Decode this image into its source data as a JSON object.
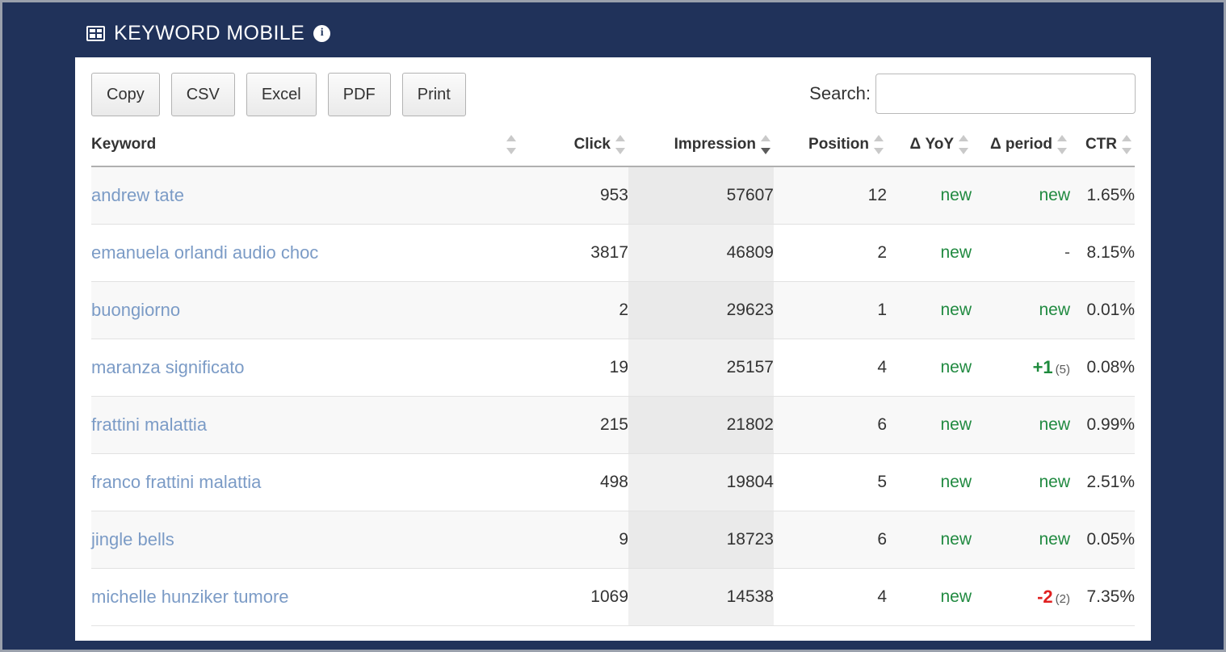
{
  "header": {
    "title": "KEYWORD MOBILE",
    "grid_icon": "grid-table-icon",
    "info_icon": "info-circle-icon"
  },
  "toolbar": {
    "buttons": [
      {
        "label": "Copy",
        "name": "copy-button"
      },
      {
        "label": "CSV",
        "name": "csv-button"
      },
      {
        "label": "Excel",
        "name": "excel-button"
      },
      {
        "label": "PDF",
        "name": "pdf-button"
      },
      {
        "label": "Print",
        "name": "print-button"
      }
    ],
    "search_label": "Search:",
    "search_value": "",
    "search_placeholder": ""
  },
  "table": {
    "columns": [
      {
        "key": "keyword",
        "label": "Keyword",
        "sort": "none"
      },
      {
        "key": "click",
        "label": "Click",
        "sort": "none"
      },
      {
        "key": "impression",
        "label": "Impression",
        "sort": "desc"
      },
      {
        "key": "position",
        "label": "Position",
        "sort": "none"
      },
      {
        "key": "yoy",
        "label": "Δ YoY",
        "sort": "none"
      },
      {
        "key": "period",
        "label": "Δ period",
        "sort": "none"
      },
      {
        "key": "ctr",
        "label": "CTR",
        "sort": "none"
      }
    ],
    "rows": [
      {
        "keyword": "andrew tate",
        "click": "953",
        "impression": "57607",
        "position": "12",
        "yoy": "new",
        "yoy_kind": "new",
        "period": "new",
        "period_paren": "",
        "period_kind": "new",
        "ctr": "1.65%"
      },
      {
        "keyword": "emanuela orlandi audio choc",
        "click": "3817",
        "impression": "46809",
        "position": "2",
        "yoy": "new",
        "yoy_kind": "new",
        "period": "-",
        "period_paren": "",
        "period_kind": "dash",
        "ctr": "8.15%"
      },
      {
        "keyword": "buongiorno",
        "click": "2",
        "impression": "29623",
        "position": "1",
        "yoy": "new",
        "yoy_kind": "new",
        "period": "new",
        "period_paren": "",
        "period_kind": "new",
        "ctr": "0.01%"
      },
      {
        "keyword": "maranza significato",
        "click": "19",
        "impression": "25157",
        "position": "4",
        "yoy": "new",
        "yoy_kind": "new",
        "period": "+1",
        "period_paren": "(5)",
        "period_kind": "positive",
        "ctr": "0.08%"
      },
      {
        "keyword": "frattini malattia",
        "click": "215",
        "impression": "21802",
        "position": "6",
        "yoy": "new",
        "yoy_kind": "new",
        "period": "new",
        "period_paren": "",
        "period_kind": "new",
        "ctr": "0.99%"
      },
      {
        "keyword": "franco frattini malattia",
        "click": "498",
        "impression": "19804",
        "position": "5",
        "yoy": "new",
        "yoy_kind": "new",
        "period": "new",
        "period_paren": "",
        "period_kind": "new",
        "ctr": "2.51%"
      },
      {
        "keyword": "jingle bells",
        "click": "9",
        "impression": "18723",
        "position": "6",
        "yoy": "new",
        "yoy_kind": "new",
        "period": "new",
        "period_paren": "",
        "period_kind": "new",
        "ctr": "0.05%"
      },
      {
        "keyword": "michelle hunziker tumore",
        "click": "1069",
        "impression": "14538",
        "position": "4",
        "yoy": "new",
        "yoy_kind": "new",
        "period": "-2",
        "period_paren": "(2)",
        "period_kind": "negative",
        "ctr": "7.35%"
      }
    ]
  },
  "colors": {
    "frame_bg": "#20325a",
    "panel_bg": "#ffffff",
    "link": "#7b9bc6",
    "positive": "#1d8a3c",
    "negative": "#e02020",
    "new": "#218a41",
    "sorted_column": "#eaeaea"
  }
}
